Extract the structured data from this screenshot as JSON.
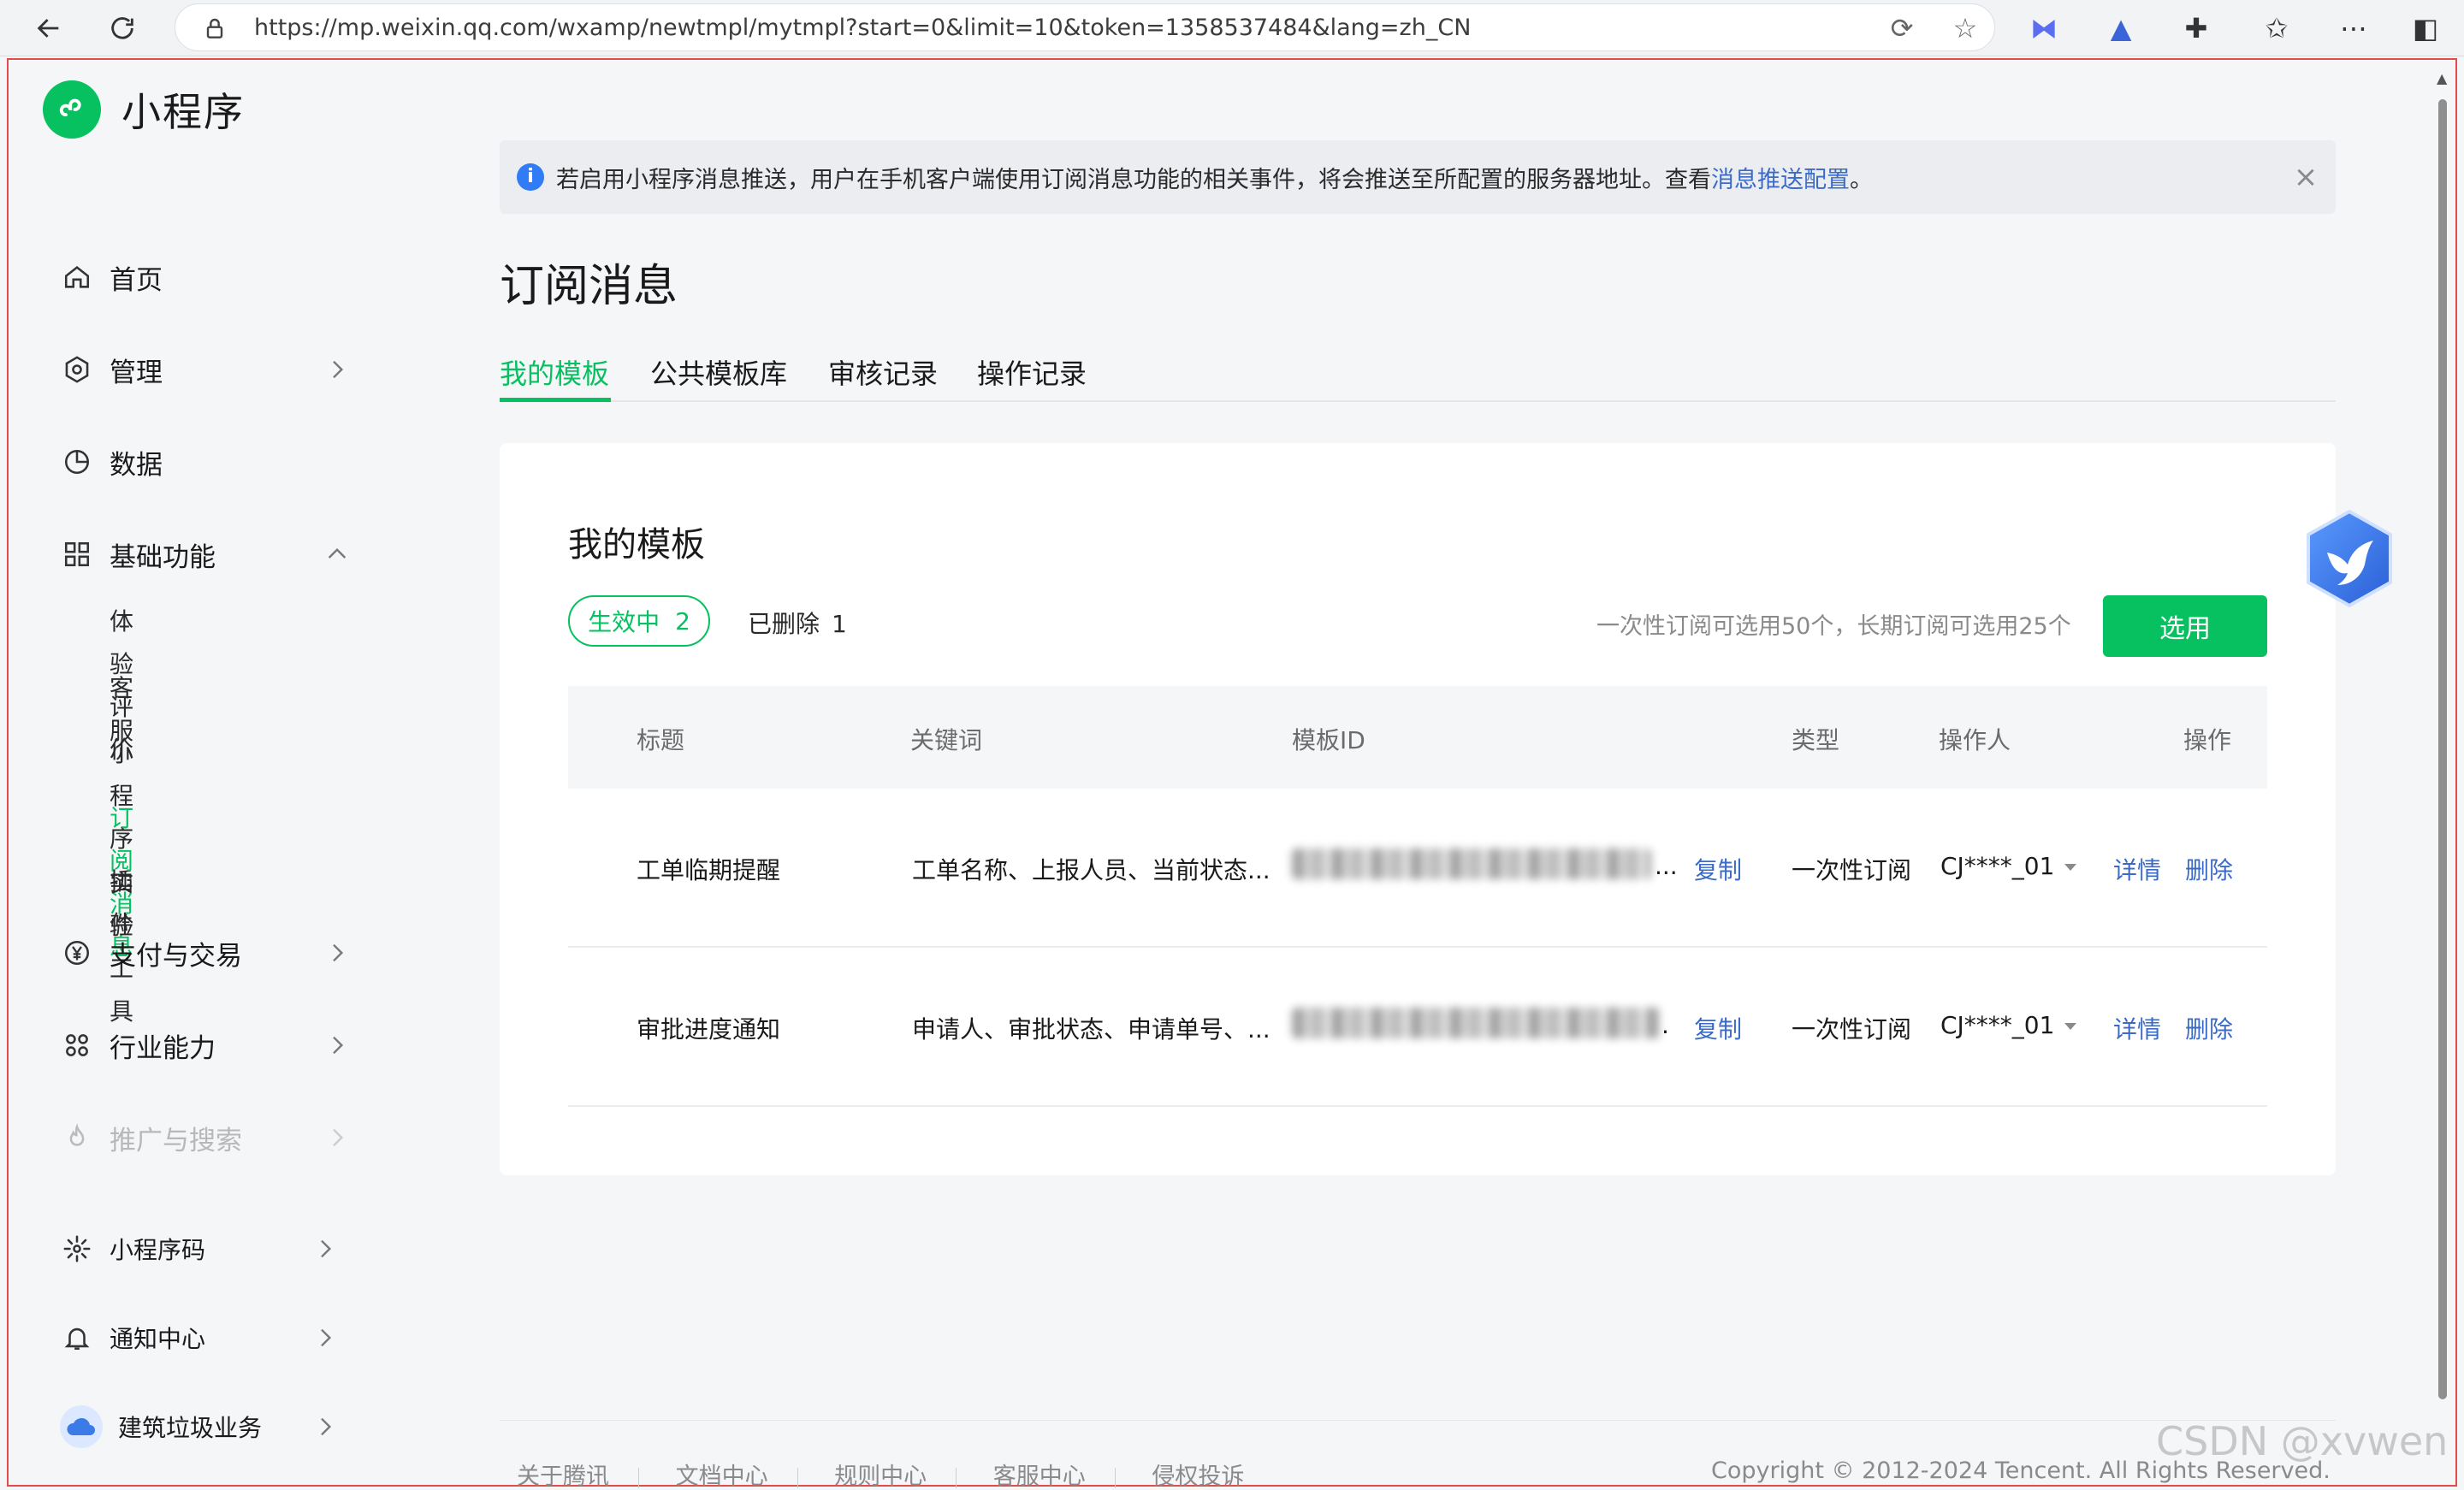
{
  "browser": {
    "url": "https://mp.weixin.qq.com/wxamp/newtmpl/mytmpl?start=0&limit=10&token=1358537484&lang=zh_CN"
  },
  "sidebar": {
    "logo_text": "小程序",
    "items": [
      {
        "label": "首页",
        "icon": "home-icon"
      },
      {
        "label": "管理",
        "icon": "manage-icon"
      },
      {
        "label": "数据",
        "icon": "chart-pie-icon"
      },
      {
        "label": "基础功能",
        "icon": "grid-icon"
      },
      {
        "label": "支付与交易",
        "icon": "yuan-icon"
      },
      {
        "label": "行业能力",
        "icon": "industry-icon"
      },
      {
        "label": "推广与搜索",
        "icon": "flame-icon"
      },
      {
        "label": "小程序码",
        "icon": "sun-code-icon"
      },
      {
        "label": "通知中心",
        "icon": "bell-icon"
      },
      {
        "label": "建筑垃圾业务",
        "icon": "cloud-avatar-icon"
      }
    ],
    "sub_items": [
      "体验评价",
      "客服",
      "小程序插件",
      "订阅消息",
      "实验工具"
    ]
  },
  "notice": {
    "text": "若启用小程序消息推送，用户在手机客户端使用订阅消息功能的相关事件，将会推送至所配置的服务器地址。查看",
    "link": "消息推送配置",
    "end": "。"
  },
  "page_title": "订阅消息",
  "tabs": [
    "我的模板",
    "公共模板库",
    "审核记录",
    "操作记录"
  ],
  "card": {
    "title": "我的模板",
    "active_filter": {
      "label": "生效中",
      "count": "2"
    },
    "deleted_filter": {
      "label": "已删除",
      "count": "1"
    },
    "quota_text": "一次性订阅可选用50个，长期订阅可选用25个",
    "select_button": "选用",
    "columns": [
      "标题",
      "关键词",
      "模板ID",
      "类型",
      "操作人",
      "操作"
    ],
    "rows": [
      {
        "title": "工单临期提醒",
        "keywords": "工单名称、上报人员、当前状态...",
        "id_suffix": "...",
        "copy": "复制",
        "type": "一次性订阅",
        "operator": "CJ****_01",
        "detail": "详情",
        "delete": "删除"
      },
      {
        "title": "审批进度通知",
        "keywords": "申请人、审批状态、申请单号、...",
        "id_suffix": ".",
        "copy": "复制",
        "type": "一次性订阅",
        "operator": "CJ****_01",
        "detail": "详情",
        "delete": "删除"
      }
    ]
  },
  "footer": {
    "links": [
      "关于腾讯",
      "文档中心",
      "规则中心",
      "客服中心",
      "侵权投诉"
    ],
    "copyright": "Copyright © 2012-2024 Tencent. All Rights Reserved."
  },
  "watermark": "CSDN @xvwen",
  "colors": {
    "accent": "#07c160",
    "link": "#3b6bc7",
    "frame_border": "#e34c4c"
  }
}
